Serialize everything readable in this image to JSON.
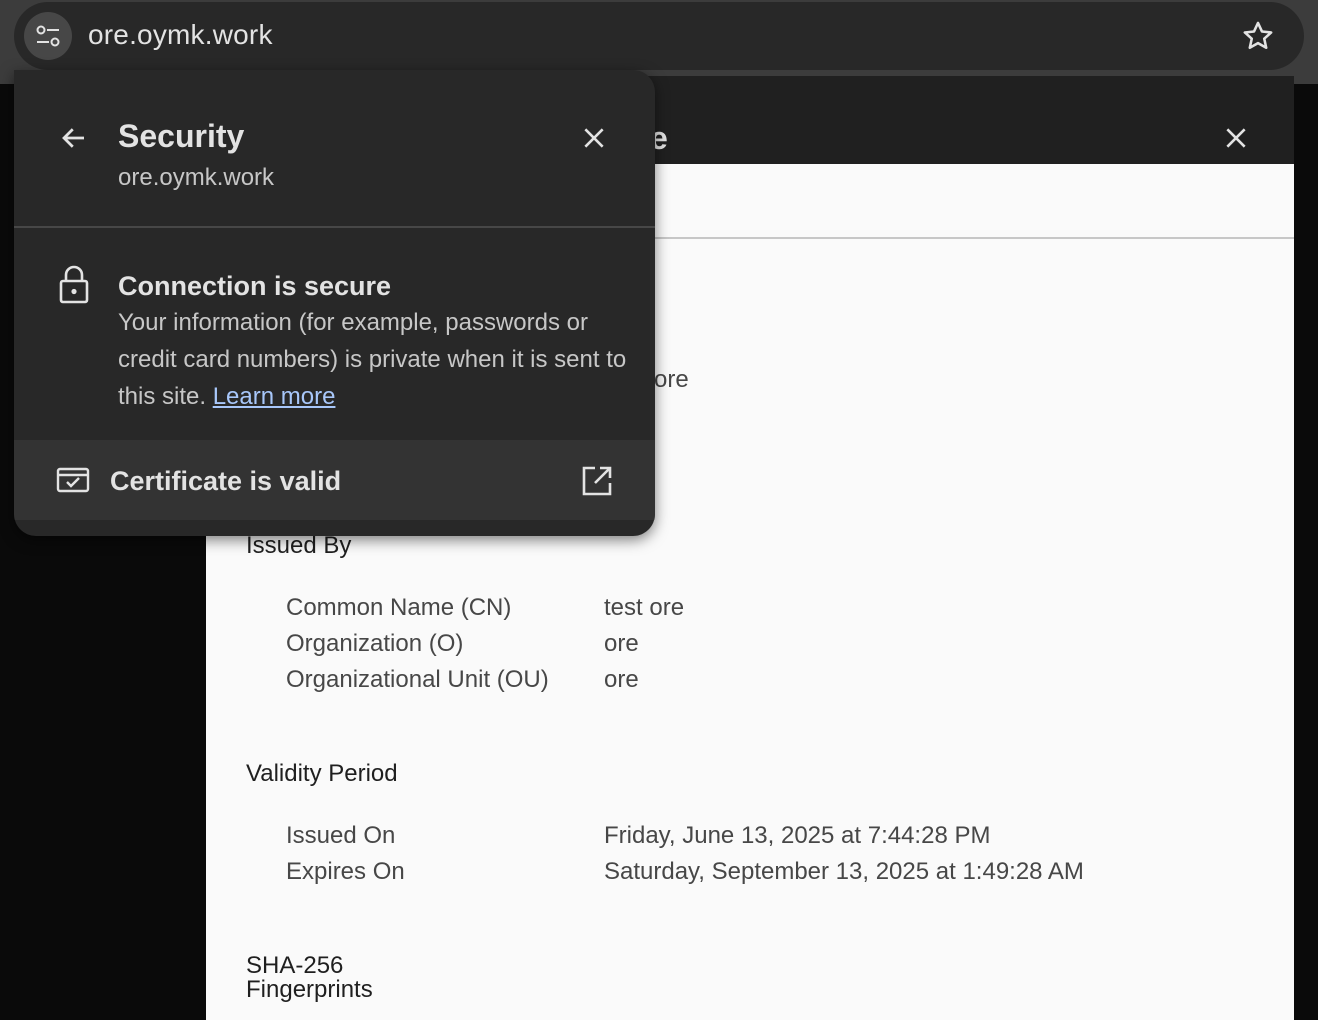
{
  "omnibox": {
    "url": "ore.oymk.work"
  },
  "popup": {
    "title": "Security",
    "site": "ore.oymk.work",
    "connection_title": "Connection is secure",
    "connection_body": "Your information (for example, passwords or credit card numbers) is private when it is sent to this site.",
    "learn_more": "Learn more",
    "certificate_label": "Certificate is valid"
  },
  "cert_viewer": {
    "title_fragment": "e",
    "partial_value": "ore",
    "issued_by": {
      "title": "Issued By",
      "rows": [
        {
          "label": "Common Name (CN)",
          "value": "test ore"
        },
        {
          "label": "Organization (O)",
          "value": "ore"
        },
        {
          "label": "Organizational Unit (OU)",
          "value": "ore"
        }
      ]
    },
    "validity": {
      "title": "Validity Period",
      "rows": [
        {
          "label": "Issued On",
          "value": "Friday, June 13, 2025 at 7:44:28 PM"
        },
        {
          "label": "Expires On",
          "value": "Saturday, September 13, 2025 at 1:49:28 AM"
        }
      ]
    },
    "fingerprints": {
      "title_line1": "SHA-256",
      "title_line2": "Fingerprints"
    }
  },
  "colors": {
    "link": "#a8c7fa",
    "popup_bg": "#282828",
    "toolbar_bg": "#3c3c3c"
  }
}
